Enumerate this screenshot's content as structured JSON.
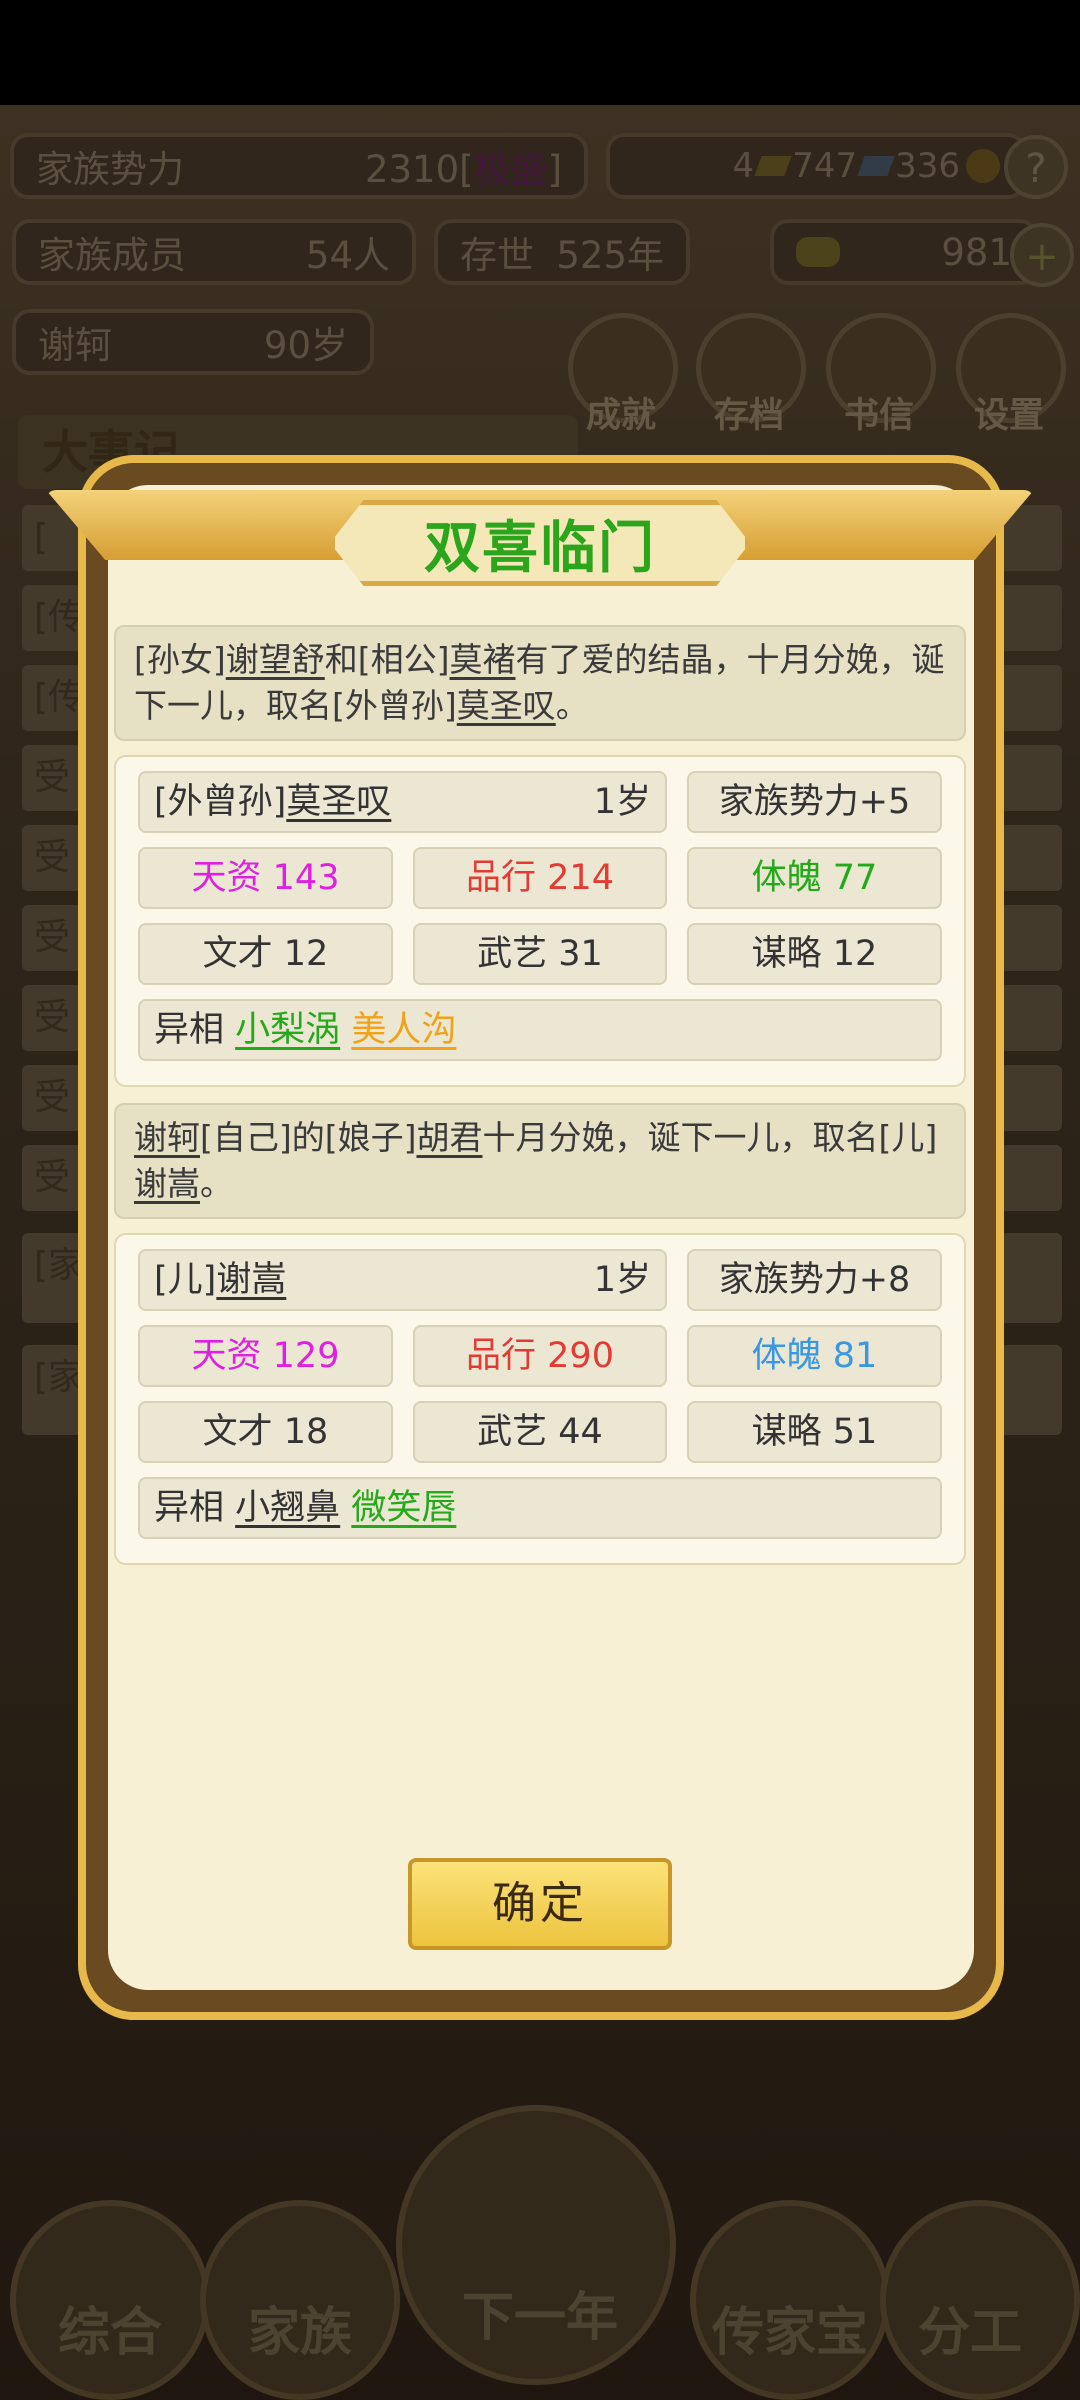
{
  "hud": {
    "power_label": "家族势力",
    "power_value": "2310[",
    "power_rank": "极盛",
    "power_close": "]",
    "currency_a": "4",
    "currency_b": "747",
    "currency_c": "336",
    "members_label": "家族成员",
    "members_value": "54人",
    "exist_label": "存世",
    "exist_value": "525年",
    "gold_value": "981",
    "patriarch_name": "谢轲",
    "patriarch_age": "90岁",
    "help": "?",
    "add": "+"
  },
  "menu": [
    {
      "label": "成就"
    },
    {
      "label": "存档"
    },
    {
      "label": "书信"
    },
    {
      "label": "设置"
    }
  ],
  "events_title": "大事记",
  "background_rows": [
    "[",
    "[传",
    "[传",
    "受",
    "受",
    "受",
    "受",
    "受",
    "受",
    "[家",
    "[家"
  ],
  "bottom_nav": [
    {
      "label": "综合"
    },
    {
      "label": "家族"
    },
    {
      "label": "下一年"
    },
    {
      "label": "传家宝"
    },
    {
      "label": "分工"
    }
  ],
  "dialog": {
    "title": "双喜临门",
    "ok_label": "确定",
    "births": [
      {
        "message": {
          "p1": "[孙女]",
          "n1": "谢望舒",
          "p2": "和[相公]",
          "n2": "莫褚",
          "p3": "有了爱的结晶，十月分娩，诞下一儿，取名[外曾孙]",
          "n3": "莫圣叹",
          "p4": "。"
        },
        "relation": "[外曾孙]",
        "name": "莫圣叹",
        "age": "1岁",
        "family_power": "家族势力+5",
        "talent": "天资 143",
        "conduct": "品行 214",
        "physique": "体魄 77",
        "literary": "文才 12",
        "martial": "武艺 31",
        "strategy": "谋略 12",
        "traits_label": "异相",
        "traits": [
          "小梨涡",
          "美人沟"
        ],
        "colors": {
          "talent": "#e020e0",
          "conduct": "#e43a34",
          "physique": "#23a91a",
          "trait1": "#23a91a",
          "trait2": "#f0a21a"
        }
      },
      {
        "message": {
          "p1": "",
          "n1": "谢轲",
          "p2": "[自己]的[娘子]",
          "n2": "胡君",
          "p3": "十月分娩，诞下一儿，取名[儿]",
          "n3": "谢嵩",
          "p4": "。"
        },
        "relation": "[儿]",
        "name": "谢嵩",
        "age": "1岁",
        "family_power": "家族势力+8",
        "talent": "天资 129",
        "conduct": "品行 290",
        "physique": "体魄 81",
        "literary": "文才 18",
        "martial": "武艺 44",
        "strategy": "谋略 51",
        "traits_label": "异相",
        "traits": [
          "小翘鼻",
          "微笑唇"
        ],
        "colors": {
          "talent": "#e020e0",
          "conduct": "#e43a34",
          "physique": "#3a97e0",
          "trait1": "#333333",
          "trait2": "#23a91a"
        }
      }
    ]
  }
}
